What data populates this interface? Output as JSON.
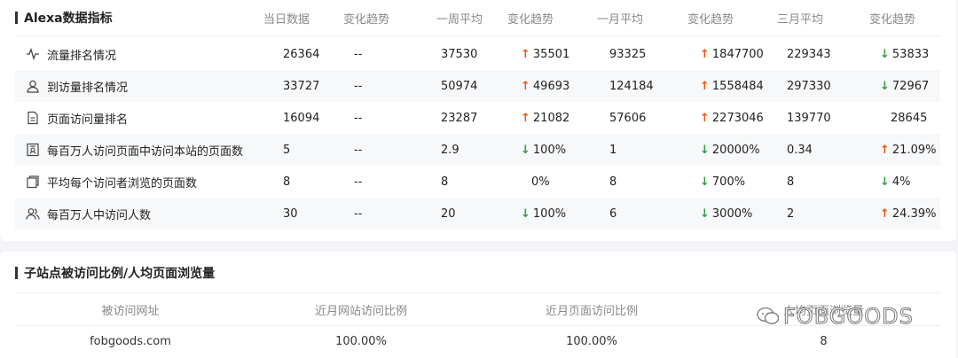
{
  "alexa": {
    "title": "Alexa数据指标",
    "columns": [
      "当日数据",
      "变化趋势",
      "一周平均",
      "变化趋势",
      "一月平均",
      "变化趋势",
      "三月平均",
      "变化趋势"
    ],
    "rows": [
      {
        "icon": "pulse-icon",
        "label": "流量排名情况",
        "day": "26364",
        "day_trend": "--",
        "week": "37530",
        "week_trend": {
          "dir": "up",
          "value": "35501"
        },
        "month": "93325",
        "month_trend": {
          "dir": "up",
          "value": "1847700"
        },
        "quarter": "229343",
        "quarter_trend": {
          "dir": "down",
          "value": "53833"
        }
      },
      {
        "icon": "user-icon",
        "label": "到访量排名情况",
        "day": "33727",
        "day_trend": "--",
        "week": "50974",
        "week_trend": {
          "dir": "up",
          "value": "49693"
        },
        "month": "124184",
        "month_trend": {
          "dir": "up",
          "value": "1558484"
        },
        "quarter": "297330",
        "quarter_trend": {
          "dir": "down",
          "value": "72967"
        }
      },
      {
        "icon": "document-icon",
        "label": "页面访问量排名",
        "day": "16094",
        "day_trend": "--",
        "week": "23287",
        "week_trend": {
          "dir": "up",
          "value": "21082"
        },
        "month": "57606",
        "month_trend": {
          "dir": "up",
          "value": "2273046"
        },
        "quarter": "139770",
        "quarter_trend": {
          "dir": "none",
          "value": "28645"
        }
      },
      {
        "icon": "id-card-icon",
        "label": "每百万人访问页面中访问本站的页面数",
        "day": "5",
        "day_trend": "--",
        "week": "2.9",
        "week_trend": {
          "dir": "down",
          "value": "100%"
        },
        "month": "1",
        "month_trend": {
          "dir": "down",
          "value": "20000%"
        },
        "quarter": "0.34",
        "quarter_trend": {
          "dir": "up",
          "value": "21.09%"
        }
      },
      {
        "icon": "pages-icon",
        "label": "平均每个访问者浏览的页面数",
        "day": "8",
        "day_trend": "--",
        "week": "8",
        "week_trend": {
          "dir": "none",
          "value": "0%"
        },
        "month": "8",
        "month_trend": {
          "dir": "down",
          "value": "700%"
        },
        "quarter": "8",
        "quarter_trend": {
          "dir": "down",
          "value": "4%"
        }
      },
      {
        "icon": "users-icon",
        "label": "每百万人中访问人数",
        "day": "30",
        "day_trend": "--",
        "week": "20",
        "week_trend": {
          "dir": "down",
          "value": "100%"
        },
        "month": "6",
        "month_trend": {
          "dir": "down",
          "value": "3000%"
        },
        "quarter": "2",
        "quarter_trend": {
          "dir": "up",
          "value": "24.39%"
        }
      }
    ]
  },
  "subsites": {
    "title": "子站点被访问比例/人均页面浏览量",
    "columns": [
      "被访问网址",
      "近月网站访问比例",
      "近月页面访问比例",
      "人均页面浏览量"
    ],
    "rows": [
      {
        "url": "fobgoods.com",
        "site_ratio": "100.00%",
        "page_ratio": "100.00%",
        "pageviews": "8"
      }
    ]
  },
  "watermark": {
    "text": "FOBGOODS",
    "icon": "wechat-icon"
  },
  "colors": {
    "up": "#e8590c",
    "down": "#2f9e44",
    "stripe": "#f7f8fa"
  }
}
